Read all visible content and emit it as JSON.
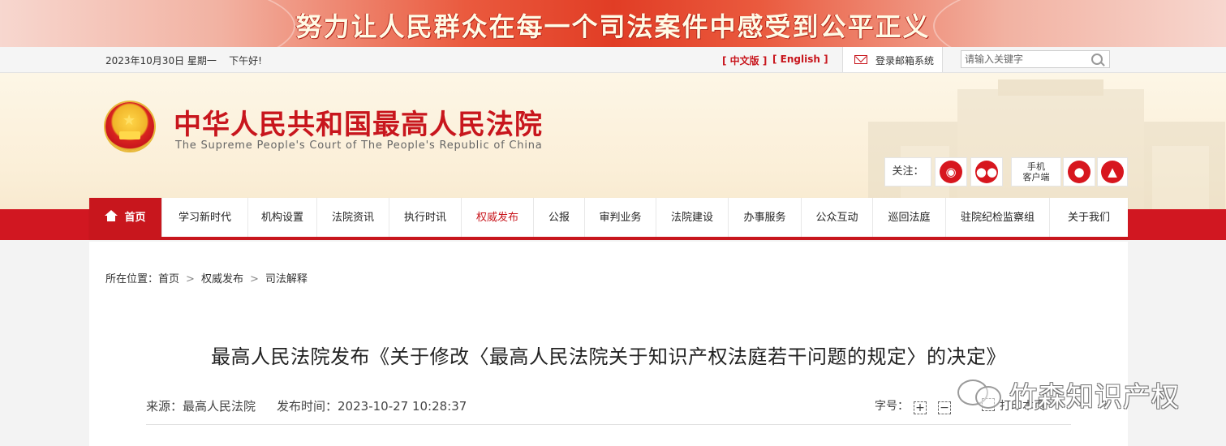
{
  "banner": {
    "slogan": "努力让人民群众在每一个司法案件中感受到公平正义"
  },
  "topbar": {
    "date": "2023年10月30日 星期一",
    "greeting": "下午好!",
    "lang_cn": "[ 中文版 ]",
    "lang_en": "[ English ]",
    "mailbox_label": "登录邮箱系统",
    "search_placeholder": "请输入关键字"
  },
  "header": {
    "title": "中华人民共和国最高人民法院",
    "subtitle": "The Supreme People's Court of The People's Republic of China",
    "follow_label": "关注：",
    "mobile_label_1": "手机",
    "mobile_label_2": "客户端"
  },
  "nav": {
    "items": [
      {
        "label": "首页"
      },
      {
        "label": "学习新时代"
      },
      {
        "label": "机构设置"
      },
      {
        "label": "法院资讯"
      },
      {
        "label": "执行时讯"
      },
      {
        "label": "权威发布"
      },
      {
        "label": "公报"
      },
      {
        "label": "审判业务"
      },
      {
        "label": "法院建设"
      },
      {
        "label": "办事服务"
      },
      {
        "label": "公众互动"
      },
      {
        "label": "巡回法庭"
      },
      {
        "label": "驻院纪检监察组"
      },
      {
        "label": "关于我们"
      }
    ],
    "active_index": 5
  },
  "breadcrumb": {
    "prefix": "所在位置：",
    "items": [
      "首页",
      "权威发布",
      "司法解释"
    ]
  },
  "article": {
    "title": "最高人民法院发布《关于修改〈最高人民法院关于知识产权法庭若干问题的规定〉的决定》",
    "source": "来源：最高人民法院",
    "published": "发布时间：2023-10-27 10:28:37",
    "font_size_label": "字号：",
    "print_label": "打印本页"
  },
  "watermark": {
    "text": "竹森知识产权"
  },
  "colors": {
    "brand_red": "#c8161d",
    "nav_band": "#d11721",
    "header_bg": "#fdf6e6"
  }
}
